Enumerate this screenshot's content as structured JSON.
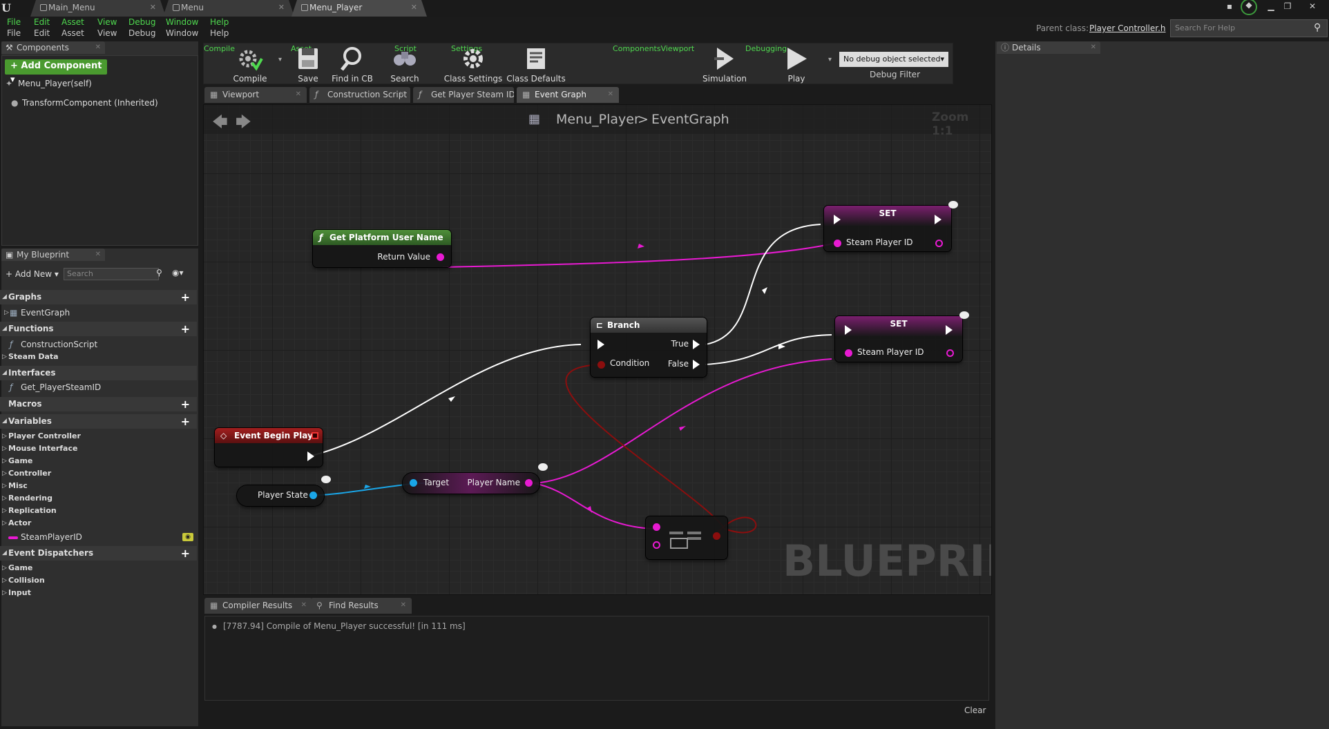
{
  "titlebar": {
    "tabs": [
      {
        "label": "Main_Menu"
      },
      {
        "label": "Menu"
      },
      {
        "label": "Menu_Player"
      }
    ]
  },
  "menu": [
    "File",
    "Edit",
    "Asset",
    "View",
    "Debug",
    "Window",
    "Help"
  ],
  "parent_class": {
    "label": "Parent class:",
    "value": "Player Controller.h"
  },
  "help_search": {
    "placeholder": "Search For Help"
  },
  "components": {
    "tab": "Components",
    "add_button": "+ Add Component ▾",
    "items": [
      "Menu_Player(self)",
      "TransformComponent (Inherited)"
    ]
  },
  "my_blueprint": {
    "tab": "My Blueprint",
    "add_new": "Add New",
    "search_placeholder": "Search",
    "sections": {
      "graphs": "Graphs",
      "graphs_items": [
        "EventGraph"
      ],
      "functions": "Functions",
      "functions_items": [
        "ConstructionScript",
        "Steam Data"
      ],
      "interfaces": "Interfaces",
      "interfaces_items": [
        "Get_PlayerSteamID"
      ],
      "macros": "Macros",
      "variables": "Variables",
      "variable_categories": [
        "Player Controller",
        "Mouse Interface",
        "Game",
        "Controller",
        "Misc",
        "Rendering",
        "Replication",
        "Actor"
      ],
      "variable_items": [
        "SteamPlayerID"
      ],
      "dispatchers": "Event Dispatchers",
      "dispatcher_categories": [
        "Game",
        "Collision",
        "Input"
      ]
    }
  },
  "toolbar": {
    "groups": [
      "Compile",
      "Asset",
      "Script",
      "Settings",
      "ComponentsViewport",
      "Debugging"
    ],
    "buttons": [
      "Compile",
      "Save",
      "Find in CB",
      "Search",
      "Class Settings",
      "Class Defaults",
      "Simulation",
      "Play"
    ],
    "debug_select": "No debug object selected▾",
    "debug_filter": "Debug Filter"
  },
  "graph_tabs": [
    "Viewport",
    "Construction Script",
    "Get Player Steam ID",
    "Event Graph"
  ],
  "graph": {
    "breadcrumb_root": "Menu_Player",
    "breadcrumb_sep": ">",
    "breadcrumb_leaf": "EventGraph",
    "zoom": "Zoom 1:1",
    "watermark": "BLUEPRINT",
    "nodes": {
      "get_platform": {
        "title": "Get Platform User Name",
        "pin": "Return Value"
      },
      "branch": {
        "title": "Branch",
        "true": "True",
        "false": "False",
        "condition": "Condition"
      },
      "set1": {
        "title": "SET",
        "pin": "Steam Player ID"
      },
      "set2": {
        "title": "SET",
        "pin": "Steam Player ID"
      },
      "event_begin": {
        "title": "Event Begin Play"
      },
      "player_state": {
        "label": "Player State"
      },
      "get_name": {
        "target": "Target",
        "out": "Player Name"
      }
    },
    "colors": {
      "exec": "#ffffff",
      "string": "#e81ad2",
      "object": "#1aa6e8",
      "bool": "#8c0e0e",
      "event": "#8b1a1a",
      "function": "#3d7a2d",
      "variable": "#7a1f6e"
    }
  },
  "bottom_tabs": [
    "Compiler Results",
    "Find Results"
  ],
  "output": {
    "line": "[7787.94] Compile of Menu_Player successful! [in 111 ms]",
    "clear": "Clear"
  },
  "details": {
    "tab": "Details"
  }
}
